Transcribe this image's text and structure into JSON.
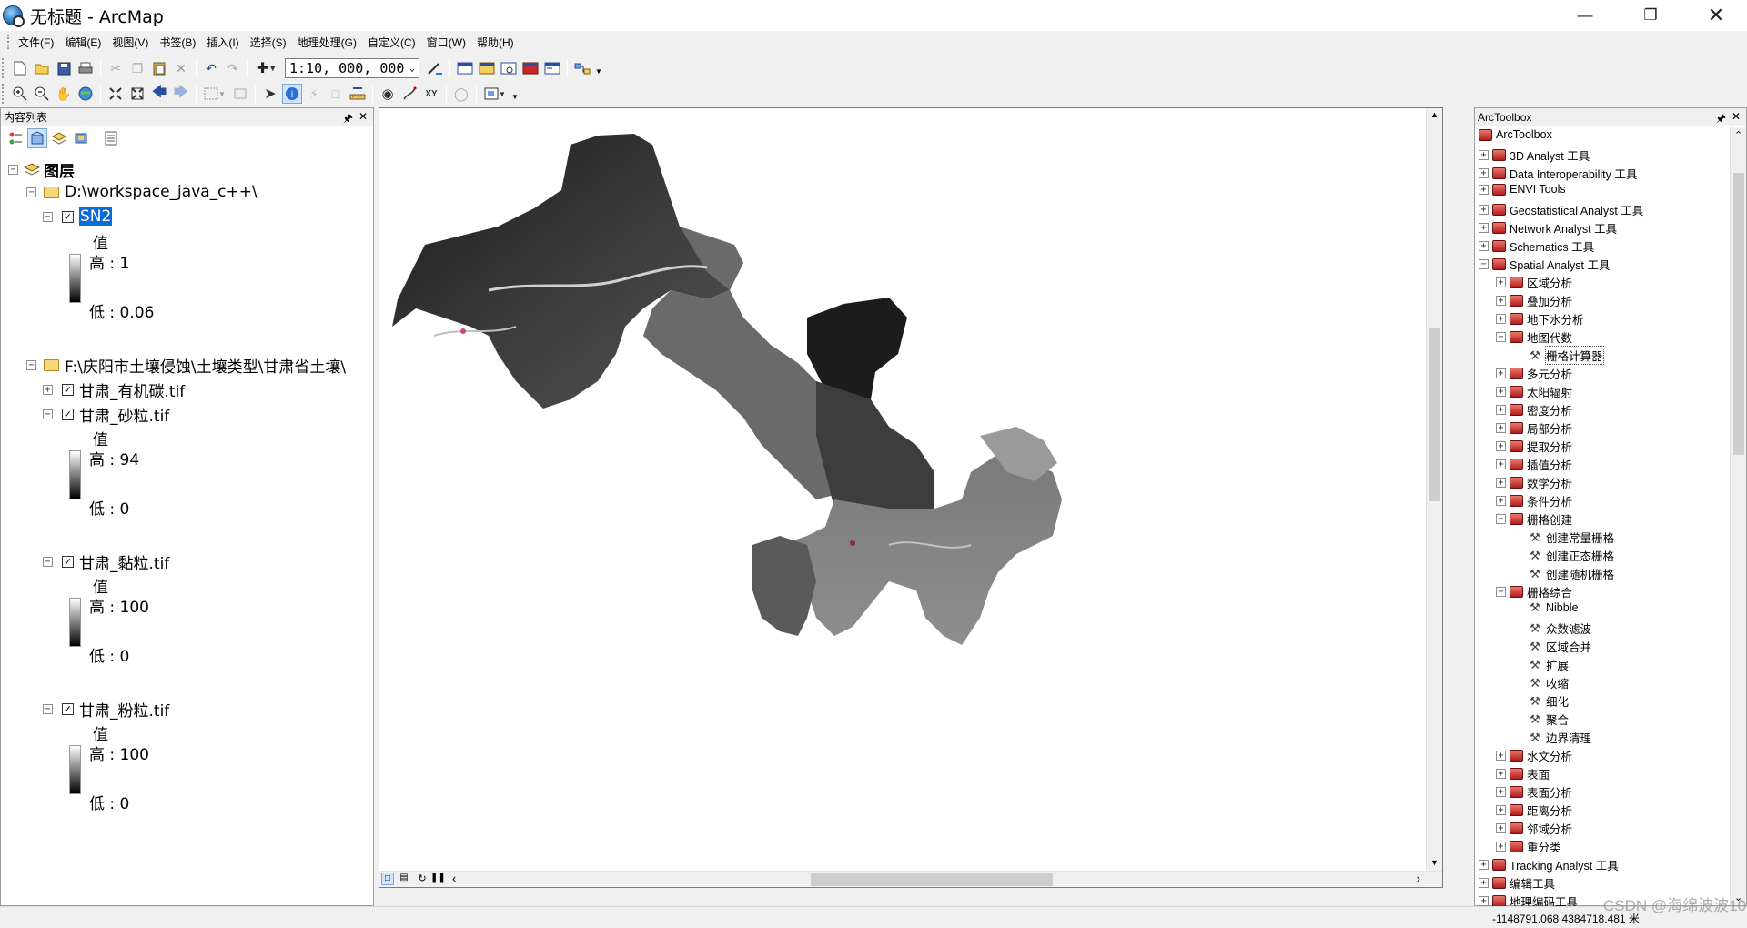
{
  "window": {
    "title": "无标题 - ArcMap"
  },
  "menu": [
    "文件(F)",
    "编辑(E)",
    "视图(V)",
    "书签(B)",
    "插入(I)",
    "选择(S)",
    "地理处理(G)",
    "自定义(C)",
    "窗口(W)",
    "帮助(H)"
  ],
  "toolbar": {
    "scale": "1:10, 000, 000"
  },
  "toc": {
    "title": "内容列表",
    "root": "图层",
    "group1": "D:\\workspace_java_c++\\",
    "sn2": {
      "name": "SN2",
      "value_label": "值",
      "high": "高 : 1",
      "low": "低 : 0.06"
    },
    "group2": "F:\\庆阳市土壤侵蚀\\土壤类型\\甘肃省土壤\\",
    "layer_carbon": "甘肃_有机碳.tif",
    "layer_sand": {
      "name": "甘肃_砂粒.tif",
      "value_label": "值",
      "high": "高 : 94",
      "low": "低 : 0"
    },
    "layer_clay": {
      "name": "甘肃_黏粒.tif",
      "value_label": "值",
      "high": "高 : 100",
      "low": "低 : 0"
    },
    "layer_silt": {
      "name": "甘肃_粉粒.tif",
      "value_label": "值",
      "high": "高 : 100",
      "low": "低 : 0"
    }
  },
  "toolbox": {
    "title": "ArcToolbox",
    "items": [
      {
        "label": "ArcToolbox",
        "level": 0,
        "kind": "root"
      },
      {
        "label": "3D Analyst 工具",
        "level": 1,
        "kind": "box",
        "exp": "+"
      },
      {
        "label": "Data Interoperability 工具",
        "level": 1,
        "kind": "box",
        "exp": "+"
      },
      {
        "label": "ENVI Tools",
        "level": 1,
        "kind": "box",
        "exp": "+"
      },
      {
        "label": "Geostatistical Analyst 工具",
        "level": 1,
        "kind": "box",
        "exp": "+"
      },
      {
        "label": "Network Analyst 工具",
        "level": 1,
        "kind": "box",
        "exp": "+"
      },
      {
        "label": "Schematics 工具",
        "level": 1,
        "kind": "box",
        "exp": "+"
      },
      {
        "label": "Spatial Analyst 工具",
        "level": 1,
        "kind": "box",
        "exp": "-"
      },
      {
        "label": "区域分析",
        "level": 2,
        "kind": "box",
        "exp": "+"
      },
      {
        "label": "叠加分析",
        "level": 2,
        "kind": "box",
        "exp": "+"
      },
      {
        "label": "地下水分析",
        "level": 2,
        "kind": "box",
        "exp": "+"
      },
      {
        "label": "地图代数",
        "level": 2,
        "kind": "box",
        "exp": "-"
      },
      {
        "label": "栅格计算器",
        "level": 3,
        "kind": "tool",
        "selected": true
      },
      {
        "label": "多元分析",
        "level": 2,
        "kind": "box",
        "exp": "+"
      },
      {
        "label": "太阳辐射",
        "level": 2,
        "kind": "box",
        "exp": "+"
      },
      {
        "label": "密度分析",
        "level": 2,
        "kind": "box",
        "exp": "+"
      },
      {
        "label": "局部分析",
        "level": 2,
        "kind": "box",
        "exp": "+"
      },
      {
        "label": "提取分析",
        "level": 2,
        "kind": "box",
        "exp": "+"
      },
      {
        "label": "插值分析",
        "level": 2,
        "kind": "box",
        "exp": "+"
      },
      {
        "label": "数学分析",
        "level": 2,
        "kind": "box",
        "exp": "+"
      },
      {
        "label": "条件分析",
        "level": 2,
        "kind": "box",
        "exp": "+"
      },
      {
        "label": "栅格创建",
        "level": 2,
        "kind": "box",
        "exp": "-"
      },
      {
        "label": "创建常量栅格",
        "level": 3,
        "kind": "tool"
      },
      {
        "label": "创建正态栅格",
        "level": 3,
        "kind": "tool"
      },
      {
        "label": "创建随机栅格",
        "level": 3,
        "kind": "tool"
      },
      {
        "label": "栅格综合",
        "level": 2,
        "kind": "box",
        "exp": "-"
      },
      {
        "label": "Nibble",
        "level": 3,
        "kind": "tool"
      },
      {
        "label": "众数滤波",
        "level": 3,
        "kind": "tool"
      },
      {
        "label": "区域合并",
        "level": 3,
        "kind": "tool"
      },
      {
        "label": "扩展",
        "level": 3,
        "kind": "tool"
      },
      {
        "label": "收缩",
        "level": 3,
        "kind": "tool"
      },
      {
        "label": "细化",
        "level": 3,
        "kind": "tool"
      },
      {
        "label": "聚合",
        "level": 3,
        "kind": "tool"
      },
      {
        "label": "边界清理",
        "level": 3,
        "kind": "tool"
      },
      {
        "label": "水文分析",
        "level": 2,
        "kind": "box",
        "exp": "+"
      },
      {
        "label": "表面",
        "level": 2,
        "kind": "box",
        "exp": "+"
      },
      {
        "label": "表面分析",
        "level": 2,
        "kind": "box",
        "exp": "+"
      },
      {
        "label": "距离分析",
        "level": 2,
        "kind": "box",
        "exp": "+"
      },
      {
        "label": "邻域分析",
        "level": 2,
        "kind": "box",
        "exp": "+"
      },
      {
        "label": "重分类",
        "level": 2,
        "kind": "box",
        "exp": "+"
      },
      {
        "label": "Tracking Analyst 工具",
        "level": 1,
        "kind": "box",
        "exp": "+"
      },
      {
        "label": "编辑工具",
        "level": 1,
        "kind": "box",
        "exp": "+"
      },
      {
        "label": "地理编码工具",
        "level": 1,
        "kind": "box",
        "exp": "+"
      }
    ]
  },
  "status": {
    "coords": "-1148791.068  4384718.481 米",
    "watermark": "CSDN @海绵波波107"
  }
}
